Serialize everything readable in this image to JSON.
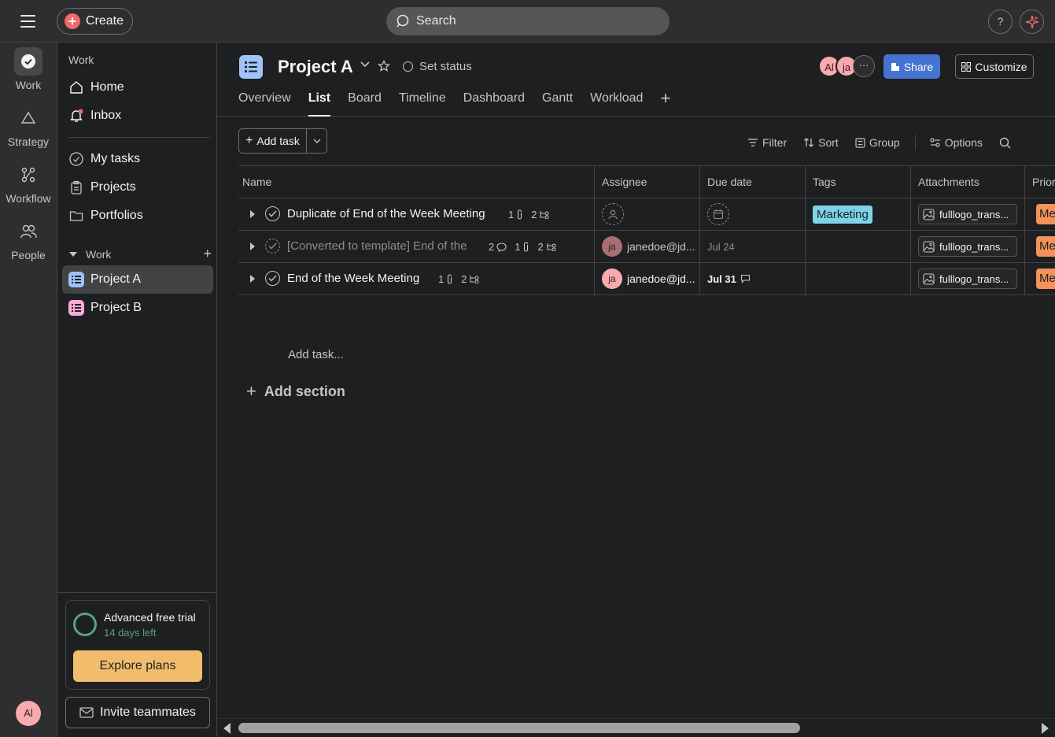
{
  "topbar": {
    "create_label": "Create",
    "search_placeholder": "Search",
    "help_label": "?"
  },
  "rail": {
    "items": [
      {
        "label": "Work",
        "icon": "check-circle-icon"
      },
      {
        "label": "Strategy",
        "icon": "triangle-icon"
      },
      {
        "label": "Workflow",
        "icon": "workflow-icon"
      },
      {
        "label": "People",
        "icon": "people-icon"
      }
    ],
    "user_initials": "Al"
  },
  "sidebar": {
    "heading": "Work",
    "nav": [
      {
        "label": "Home",
        "icon": "home-icon"
      },
      {
        "label": "Inbox",
        "icon": "bell-icon"
      }
    ],
    "nav2": [
      {
        "label": "My tasks",
        "icon": "check-circle-icon"
      },
      {
        "label": "Projects",
        "icon": "clipboard-icon"
      },
      {
        "label": "Portfolios",
        "icon": "folder-icon"
      }
    ],
    "section_label": "Work",
    "projects": [
      {
        "label": "Project A",
        "color": "#9ec3f7"
      },
      {
        "label": "Project B",
        "color": "#f9aad8"
      }
    ],
    "trial": {
      "title": "Advanced free trial",
      "subtitle": "14 days left",
      "explore_label": "Explore plans"
    },
    "invite_label": "Invite teammates"
  },
  "project": {
    "title": "Project A",
    "set_status_label": "Set status",
    "members": [
      "Al",
      "ja"
    ],
    "share_label": "Share",
    "customize_label": "Customize",
    "tabs": [
      "Overview",
      "List",
      "Board",
      "Timeline",
      "Dashboard",
      "Gantt",
      "Workload"
    ],
    "active_tab": "List"
  },
  "toolbar": {
    "add_task_label": "Add task",
    "filter_label": "Filter",
    "sort_label": "Sort",
    "group_label": "Group",
    "options_label": "Options"
  },
  "table": {
    "columns": [
      "Name",
      "Assignee",
      "Due date",
      "Tags",
      "Attachments",
      "Prior"
    ],
    "rows": [
      {
        "name": "Duplicate of End of the Week Meeting",
        "comments": "",
        "attachments_count": "1",
        "subtasks": "2",
        "assignee": "",
        "assignee_initials": "",
        "due": "",
        "tag": "Marketing",
        "attachment": "fulllogo_trans...",
        "priority": "Me"
      },
      {
        "name": "[Converted to template] End of the",
        "comments": "2",
        "attachments_count": "1",
        "subtasks": "2",
        "assignee": "janedoe@jd....",
        "assignee_initials": "ja",
        "due": "Jul 24",
        "tag": "",
        "attachment": "fulllogo_trans...",
        "priority": "Me"
      },
      {
        "name": "End of the Week Meeting",
        "comments": "",
        "attachments_count": "1",
        "subtasks": "2",
        "assignee": "janedoe@jd....",
        "assignee_initials": "ja",
        "due": "Jul 31",
        "tag": "",
        "attachment": "fulllogo_trans...",
        "priority": "Me"
      }
    ],
    "add_task_link": "Add task...",
    "add_section_label": "Add section"
  },
  "colors": {
    "accent_blue": "#4573d2",
    "trial_green": "#58a182",
    "explore_orange": "#f1bd6c",
    "tag_marketing": "#7dd3e8",
    "priority_medium": "#f3925c"
  }
}
